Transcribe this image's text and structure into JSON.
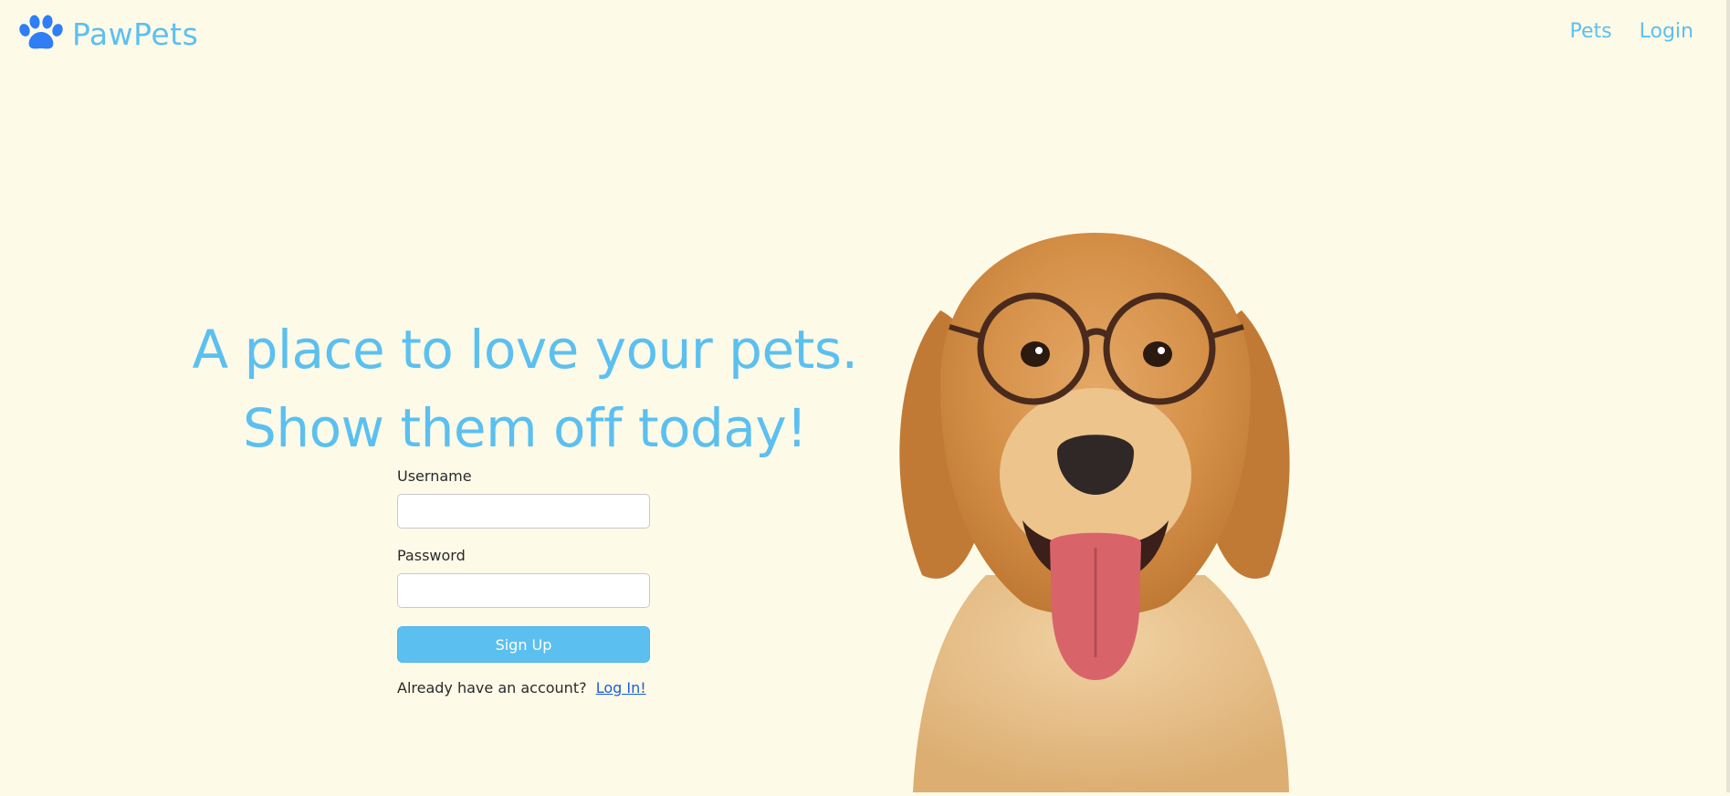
{
  "nav": {
    "brand": "PawPets",
    "links": [
      "Pets",
      "Login"
    ]
  },
  "hero": {
    "line1": "A place to love your pets.",
    "line2": "Show them off today!"
  },
  "form": {
    "username_label": "Username",
    "username_value": "",
    "password_label": "Password",
    "password_value": "",
    "submit_label": "Sign Up",
    "login_prompt": "Already have an account?",
    "login_link": "Log In!"
  },
  "colors": {
    "background": "#fefae8",
    "accent": "#5bc0f0",
    "link": "#1a5fd6"
  },
  "icons": {
    "logo": "paw-icon"
  }
}
